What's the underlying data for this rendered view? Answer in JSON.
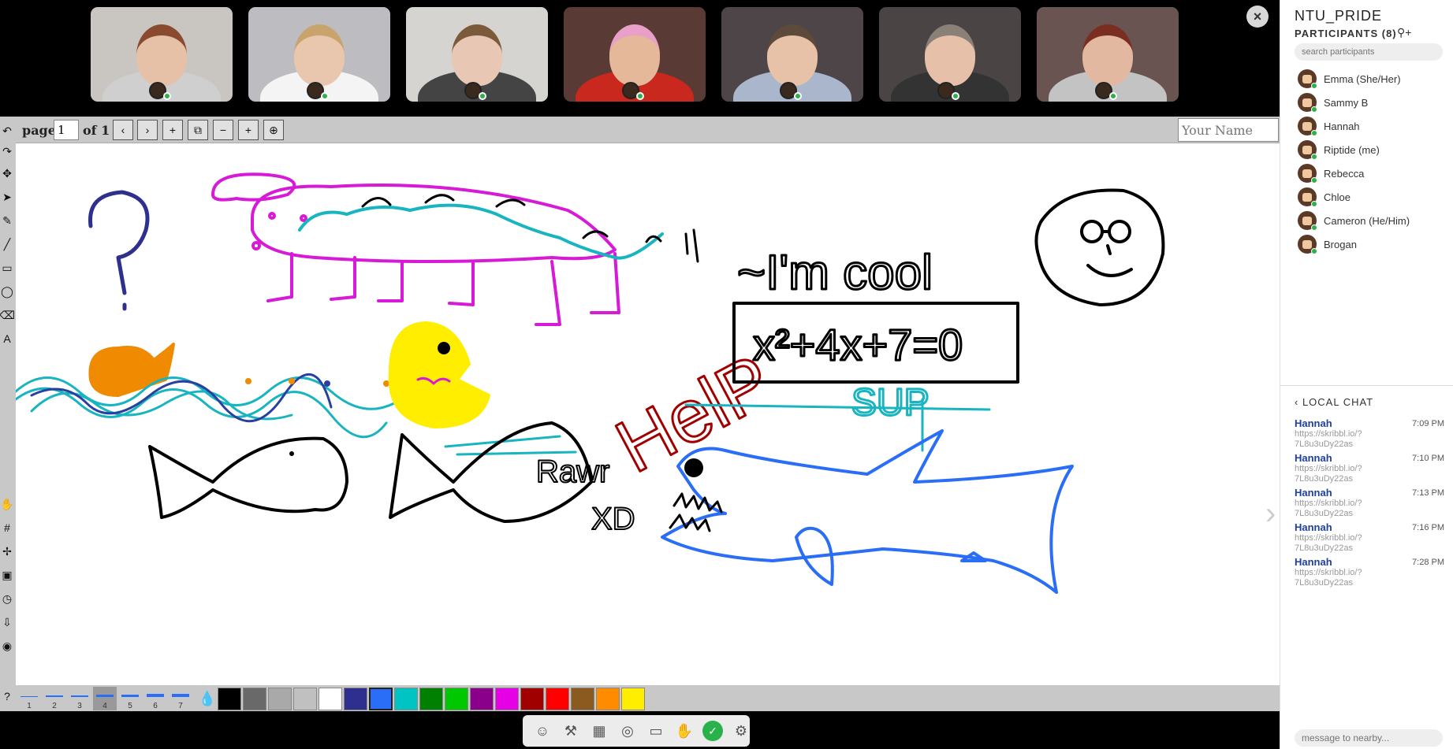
{
  "video_strip": {
    "close_label": "×",
    "tiles": [
      {
        "bg": "#c9c5c0",
        "skin": "#e7c0a8",
        "shirt": "#cfcfcf",
        "hair": "#8a4a30"
      },
      {
        "bg": "#bdbcc0",
        "skin": "#e9c6ae",
        "shirt": "#f4f4f4",
        "hair": "#c9a36c"
      },
      {
        "bg": "#d6d4d0",
        "skin": "#e8c8b4",
        "shirt": "#444",
        "hair": "#7a5a3a"
      },
      {
        "bg": "#5a3a34",
        "skin": "#e5b89a",
        "shirt": "#c8281e",
        "hair": "#e9a0c8"
      },
      {
        "bg": "#4e4548",
        "skin": "#e7c2a8",
        "shirt": "#a9b6cc",
        "hair": "#5e4a3a"
      },
      {
        "bg": "#4a4444",
        "skin": "#e6c0a8",
        "shirt": "#333",
        "hair": "#8a8078"
      },
      {
        "bg": "#6a5452",
        "skin": "#e2b8a0",
        "shirt": "#c3c3c3",
        "hair": "#7a2e22"
      }
    ]
  },
  "toolbar": {
    "page_label": "page",
    "page_value": "1",
    "of_label": "of 1",
    "name_placeholder": "Your Name",
    "buttons": [
      {
        "name": "prev-page-button",
        "glyph": "‹"
      },
      {
        "name": "next-page-button",
        "glyph": "›"
      },
      {
        "name": "add-page-button",
        "glyph": "+"
      },
      {
        "name": "duplicate-page-button",
        "glyph": "⧉"
      },
      {
        "name": "zoom-out-button",
        "glyph": "−"
      },
      {
        "name": "zoom-in-button",
        "glyph": "+"
      },
      {
        "name": "zoom-fit-button",
        "glyph": "⊕"
      }
    ]
  },
  "left_tools": [
    {
      "name": "undo-icon",
      "glyph": "↶"
    },
    {
      "name": "redo-icon",
      "glyph": "↷"
    },
    {
      "name": "move-icon",
      "glyph": "✥"
    },
    {
      "name": "select-arrow-icon",
      "glyph": "➤"
    },
    {
      "name": "pencil-icon",
      "glyph": "✎"
    },
    {
      "name": "line-icon",
      "glyph": "╱"
    },
    {
      "name": "rectangle-icon",
      "glyph": "▭"
    },
    {
      "name": "ellipse-icon",
      "glyph": "◯"
    },
    {
      "name": "eraser-icon",
      "glyph": "⌫"
    },
    {
      "name": "text-icon",
      "glyph": "A"
    },
    {
      "name": "hand-icon",
      "glyph": "✋"
    },
    {
      "name": "grid-icon",
      "glyph": "#"
    },
    {
      "name": "snap-icon",
      "glyph": "✢"
    },
    {
      "name": "image-icon",
      "glyph": "▣"
    },
    {
      "name": "history-icon",
      "glyph": "◷"
    },
    {
      "name": "svg-export-icon",
      "glyph": "⇩"
    },
    {
      "name": "github-icon",
      "glyph": "◉"
    },
    {
      "name": "help-icon",
      "glyph": "?"
    }
  ],
  "canvas": {
    "texts": {
      "im_cool": "~I'm cool",
      "equation": "x²+4x+7=0",
      "sup": "SUP",
      "help": "HelP",
      "rawr": "Rawr",
      "xd": "XD"
    }
  },
  "palette": {
    "widths": [
      "1",
      "2",
      "3",
      "4",
      "5",
      "6",
      "7"
    ],
    "selected_width": "4",
    "colors": [
      "#000000",
      "#696969",
      "#a9a9a9",
      "#c0c0c0",
      "#ffffff",
      "#2f2f8f",
      "#2a6df6",
      "#00c4c4",
      "#008000",
      "#00c800",
      "#8b008b",
      "#e600e6",
      "#a00000",
      "#ff0000",
      "#8b5a1e",
      "#ff8c00",
      "#ffee00"
    ],
    "selected_color": "#2a6df6"
  },
  "bottom_bar": [
    {
      "name": "avatar-button",
      "glyph": "☺"
    },
    {
      "name": "hammer-icon",
      "glyph": "⚒"
    },
    {
      "name": "map-icon",
      "glyph": "▦"
    },
    {
      "name": "target-icon",
      "glyph": "◎"
    },
    {
      "name": "screen-share-icon",
      "glyph": "▭"
    },
    {
      "name": "raise-hand-icon",
      "glyph": "✋"
    },
    {
      "name": "status-check-icon",
      "glyph": "✓"
    },
    {
      "name": "settings-gear-icon",
      "glyph": "⚙"
    }
  ],
  "panel": {
    "room_title": "NTU_PRIDE",
    "participants_header": "PARTICIPANTS (8)",
    "add_user_glyph": "⚲+",
    "search_placeholder": "search participants",
    "participants": [
      "Emma (She/Her)",
      "Sammy B",
      "Hannah",
      "Riptide (me)",
      "Rebecca",
      "Chloe",
      "Cameron (He/Him)",
      "Brogan"
    ],
    "chat_header": "‹  LOCAL CHAT",
    "messages": [
      {
        "who": "Hannah",
        "time": "7:09 PM",
        "text": "https://skribbl.io/?7L8u3uDy22as"
      },
      {
        "who": "Hannah",
        "time": "7:10 PM",
        "text": "https://skribbl.io/?7L8u3uDy22as"
      },
      {
        "who": "Hannah",
        "time": "7:13 PM",
        "text": "https://skribbl.io/?7L8u3uDy22as"
      },
      {
        "who": "Hannah",
        "time": "7:16 PM",
        "text": "https://skribbl.io/?7L8u3uDy22as"
      },
      {
        "who": "Hannah",
        "time": "7:28 PM",
        "text": "https://skribbl.io/?7L8u3uDy22as"
      }
    ],
    "chat_placeholder": "message to nearby..."
  }
}
